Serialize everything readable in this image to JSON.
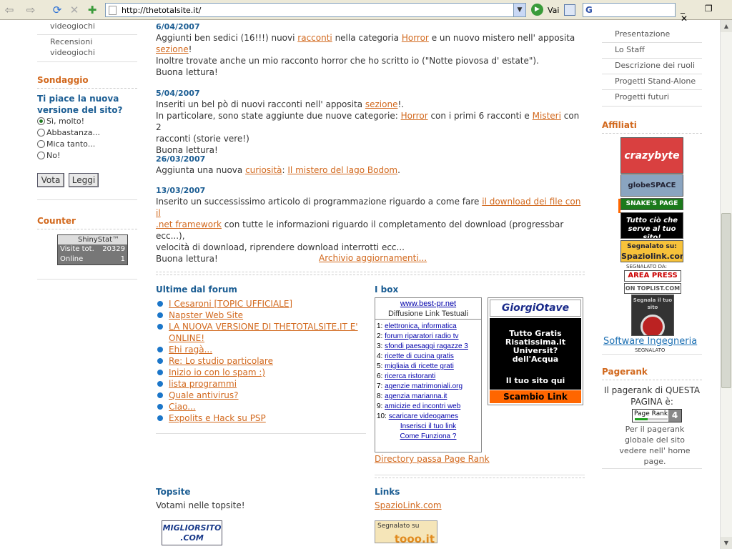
{
  "browser": {
    "url": "http://thetotalsite.it/",
    "go_label": "Vai",
    "search_logo": "G",
    "back_icon": "⇦",
    "forward_icon": "⇨",
    "refresh_icon": "⟳",
    "stop_icon": "✕",
    "window_controls": "_ ❐ ✕"
  },
  "left": {
    "menu_items": [
      "videogiochi",
      "Recensioni videogiochi"
    ],
    "poll": {
      "title": "Sondaggio",
      "question": "Ti piace la nuova versione del sito?",
      "options": [
        "Sì, molto!",
        "Abbastanza...",
        "Mica tanto...",
        "No!"
      ],
      "selected": 0,
      "vote_label": "Vota",
      "read_label": "Leggi"
    },
    "counter": {
      "title": "Counter",
      "brand": "ShinyStat™",
      "visits_label": "Visite tot.",
      "visits_value": "20329",
      "online_label": "Online",
      "online_value": "1"
    }
  },
  "news": [
    {
      "date": "6/04/2007",
      "l1a": "Aggiunti ben sedici (16!!!) nuovi ",
      "l1link1": "racconti",
      "l1b": " nella categoria ",
      "l1link2": "Horror",
      "l1c": " e un nuovo mistero nell' apposita",
      "l2link": "sezione",
      "l2b": "!",
      "l3": "Inoltre trovate anche un mio racconto horror che ho scritto io (\"Notte piovosa d' estate\").",
      "l4": "Buona lettura!"
    },
    {
      "date": "5/04/2007",
      "l1a": "Inseriti un bel pò di nuovi racconti nell' apposita ",
      "l1link": "sezione",
      "l1b": "!.",
      "l2a": "In particolare, sono state aggiunte due nuove categorie: ",
      "l2link1": "Horror",
      "l2b": " con i primi 6 racconti e ",
      "l2link2": "Misteri",
      "l2c": " con 2",
      "l3": "racconti (storie vere!)",
      "l4": "Buona lettura!"
    },
    {
      "date": "26/03/2007",
      "l1a": "Aggiunta una nuova ",
      "l1link1": "curiosità",
      "l1b": ": ",
      "l1link2": "Il mistero del lago Bodom",
      "l1c": "."
    },
    {
      "date": "13/03/2007",
      "l1a": "Inserito un successissimo articolo di programmazione riguardo a come fare ",
      "l1link": "il download dei file con il",
      "l2link": ".net framework",
      "l2b": " con tutte le informazioni riguardo il completamento del download (progressbar ecc...),",
      "l3": "velocità di download, riprendere download interrotti ecc...",
      "l4": "Buona lettura!"
    }
  ],
  "archive_label": "Archivio aggiornamenti...",
  "forum": {
    "title": "Ultime dal forum",
    "items": [
      "I Cesaroni [TOPIC UFFICIALE]",
      "Napster Web Site",
      "LA NUOVA VERSIONE DI THETOTALSITE.IT E' ONLINE!",
      "Ehi ragà...",
      "Re: Lo studio particolare",
      "Inizio io con lo spam :)",
      "lista programmi",
      "Quale antivirus?",
      "Ciao...",
      "Expolits e Hack su PSP"
    ]
  },
  "ibox": {
    "title": "I box",
    "head_link": "www.best-pr.net",
    "head_text": "Diffusione Link Testuali",
    "links": [
      "elettronica, informatica",
      "forum riparatori radio tv",
      "sfondi paesaggi ragazze 3",
      "ricette di cucina gratis",
      "migliaia di ricette grati",
      "ricerca ristoranti",
      "agenzie matrimoniali.org",
      "agenzia marianna.it",
      "amicizie ed incontri web",
      "scaricare videogames"
    ],
    "insert_link": "Inserisci il tuo link",
    "how_link": "Come Funziona ?",
    "directory_link": "Directory passa Page Rank",
    "giorgio": {
      "logo": "GiorgiOtave",
      "line1": "Tutto Gratis",
      "line2": "Risatissima.it",
      "line3": "Universit? dell'Acqua",
      "line4": "Il tuo sito qui",
      "bar": "Scambio Link"
    }
  },
  "topsite": {
    "title": "Topsite",
    "text": "Votami nelle topsite!",
    "badge_line1": "MIGLIORSITO",
    "badge_line2": ".COM"
  },
  "links_section": {
    "title": "Links",
    "spazio": "SpazioLink.com",
    "tooo_small": "Segnalato su",
    "tooo_brand": "tooo.it"
  },
  "right": {
    "menu_items": [
      "Presentazione",
      "Lo Staff",
      "Descrizione dei ruoli",
      "Progetti Stand-Alone",
      "Progetti futuri"
    ],
    "affiliati_title": "Affiliati",
    "aff_crazybyte": "crazybyte",
    "aff_globe": "globeSPACE",
    "aff_snake": "SNAKE'S PAGE",
    "aff_tutto": "Tutto ciò che serve al tuo sito!",
    "aff_spazio_small": "Segnalato su:",
    "aff_spazio_big": "Spaziolink.com",
    "aff_segnalato": "SEGNALATO DA:",
    "aff_areapress": "AREA PRESS",
    "aff_toplist": "ON TOPLIST.COM",
    "aff_segnala": "Segnala il tuo sito",
    "software_link": "Software Ingegneria",
    "software_sub": "SEGNALATO",
    "pagerank_title": "Pagerank",
    "pagerank_text": "Il pagerank di QUESTA PAGINA è:",
    "pagerank_label": "Page Rank",
    "pagerank_value": "4",
    "pagerank_fraction": 0.4,
    "pagerank_sub": "Per il pagerank globale del sito vedere nell' home page."
  },
  "colors": {
    "accent": "#d2691e",
    "heading_blue": "#1b5d93",
    "link_blue": "#1b6fb3"
  }
}
